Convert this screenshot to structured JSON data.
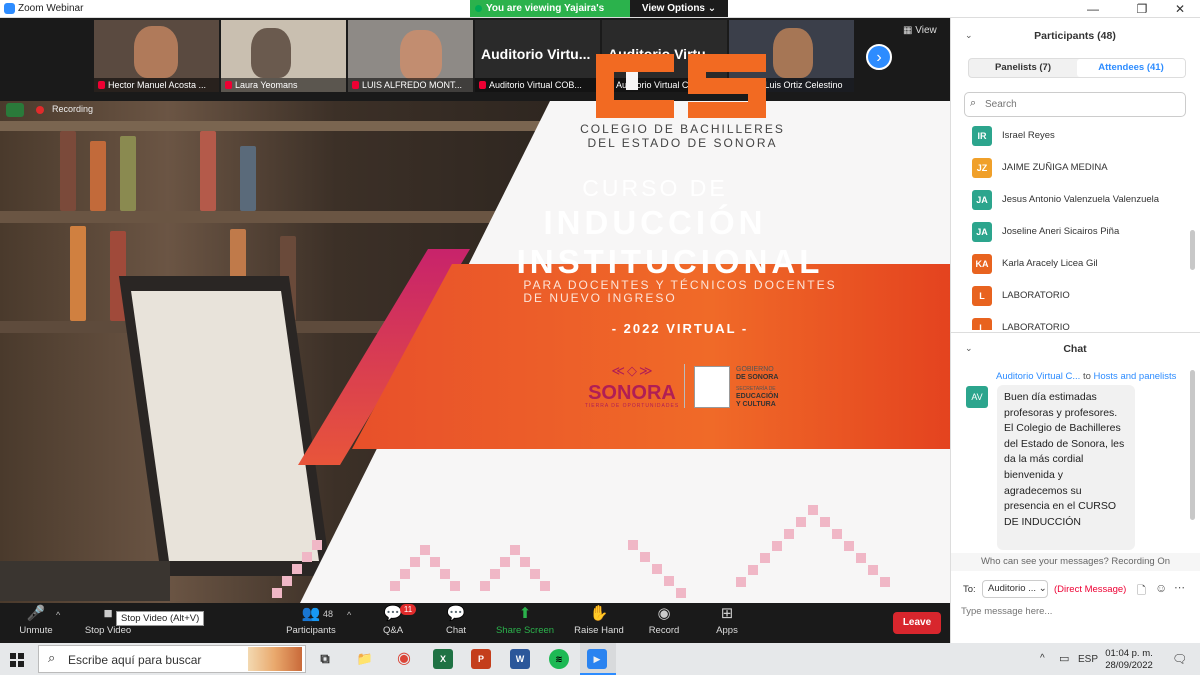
{
  "window": {
    "title": "Zoom Webinar",
    "minimize": "—",
    "maximize": "❐",
    "close": "✕"
  },
  "banner": {
    "viewing": "You are viewing Yajaira's screen",
    "view_options": "View Options ⌄"
  },
  "strip": {
    "tiles": [
      {
        "name": "Hector Manuel Acosta ..."
      },
      {
        "name": "Laura Yeomans"
      },
      {
        "name": "LUIS ALFREDO MONT..."
      },
      {
        "name": "Auditorio Virtual COB...",
        "label": "Auditorio Virtu..."
      },
      {
        "name": "Auditorio Virtual COB...",
        "label": "Auditorio Virtu..."
      },
      {
        "name": "José Luis Ortiz Celestino"
      }
    ],
    "next": "›",
    "view": "▦ View"
  },
  "recording": {
    "label": "Recording"
  },
  "slide": {
    "cobach_line1": "COLEGIO DE BACHILLERES",
    "cobach_line2": "DEL ESTADO DE SONORA",
    "curso": "CURSO DE",
    "induccion": "INDUCCIÓN",
    "institucional": "INSTITUCIONAL",
    "para1": "PARA DOCENTES Y TÉCNICOS DOCENTES",
    "para2": "DE NUEVO INGRESO",
    "year": "- 2022 VIRTUAL -",
    "sonora_pattern": "≪◇≫",
    "sonora": "SONORA",
    "sonora_tag": "TIERRA DE OPORTUNIDADES",
    "gob1": "GOBIERNO",
    "gob2": "DE SONORA",
    "gob3": "SECRETARÍA DE",
    "gob4": "EDUCACIÓN",
    "gob5": "Y CULTURA"
  },
  "toolbar": {
    "unmute": {
      "icon": "🎤",
      "label": "Unmute"
    },
    "stop_video": {
      "icon": "■",
      "label": "Stop Video"
    },
    "tooltip": "Stop Video (Alt+V)",
    "participants": {
      "icon": "👥",
      "label": "Participants",
      "count": "48"
    },
    "qa": {
      "icon": "💬",
      "label": "Q&A",
      "badge": "11"
    },
    "chat": {
      "icon": "💬",
      "label": "Chat"
    },
    "share": {
      "icon": "⬆",
      "label": "Share Screen"
    },
    "raise": {
      "icon": "✋",
      "label": "Raise Hand"
    },
    "record": {
      "icon": "◉",
      "label": "Record"
    },
    "apps": {
      "icon": "⊞",
      "label": "Apps"
    },
    "leave": "Leave",
    "caret": "^"
  },
  "participants_panel": {
    "chevron": "⌄",
    "title": "Participants (48)",
    "tab_panelists": "Panelists (7)",
    "tab_attendees": "Attendees (41)",
    "search_placeholder": "Search",
    "search_icon": "⌕",
    "list": [
      {
        "initials": "IR",
        "name": "Israel Reyes",
        "color": "#2ca58d"
      },
      {
        "initials": "JZ",
        "name": "JAIME ZUÑIGA MEDINA",
        "color": "#f0a02a"
      },
      {
        "initials": "JA",
        "name": "Jesus Antonio Valenzuela Valenzuela",
        "color": "#2ca58d"
      },
      {
        "initials": "JA",
        "name": "Joseline Aneri Sicairos Piña",
        "color": "#2ca58d"
      },
      {
        "initials": "KA",
        "name": "Karla Aracely Licea Gil",
        "color": "#e8631f"
      },
      {
        "initials": "L",
        "name": "LABORATORIO",
        "color": "#e8631f"
      },
      {
        "initials": "L",
        "name": "LABORATORIO",
        "color": "#e8631f"
      }
    ]
  },
  "chat_panel": {
    "chevron": "⌄",
    "title": "Chat",
    "from": "Auditorio Virtual C...",
    "to_word": " to ",
    "to": "Hosts and panelists",
    "avatar": "AV",
    "message": "Buen día estimadas profesoras y profesores. El Colegio de Bachilleres del Estado de Sonora, les da la más cordial bienvenida y agradecemos su presencia en el CURSO DE INDUCCIÓN",
    "who_can_see": "Who can see your messages? Recording On",
    "to_label": "To:",
    "to_select": "Auditorio ... ⌄",
    "direct": "(Direct Message)",
    "input_placeholder": "Type message here...",
    "file_icon": "🗋",
    "emoji_icon": "☺",
    "more_icon": "⋯"
  },
  "taskbar": {
    "search_text": "Escribe aquí para buscar",
    "search_icon": "⌕",
    "apps": [
      {
        "name": "task-view",
        "glyph": "⧉",
        "color": "#e6e8ea",
        "fg": "#333"
      },
      {
        "name": "file-explorer",
        "glyph": "📁",
        "color": "#e6e8ea",
        "fg": "#d9a21b"
      },
      {
        "name": "chrome",
        "glyph": "◉",
        "color": "#e6e8ea",
        "fg": "#db4437"
      },
      {
        "name": "excel",
        "glyph": "X",
        "color": "#1f7244",
        "fg": "#fff"
      },
      {
        "name": "powerpoint",
        "glyph": "P",
        "color": "#c43e1c",
        "fg": "#fff"
      },
      {
        "name": "word",
        "glyph": "W",
        "color": "#2b579a",
        "fg": "#fff"
      },
      {
        "name": "spotify",
        "glyph": "≋",
        "color": "#1db954",
        "fg": "#000"
      },
      {
        "name": "zoom",
        "glyph": "▶",
        "color": "#2d8cff",
        "fg": "#fff"
      }
    ],
    "tray_chevron": "^",
    "tray_network": "▭",
    "lang": "ESP",
    "time": "01:04 p. m.",
    "date": "28/09/2022",
    "notifications": "🗨"
  }
}
